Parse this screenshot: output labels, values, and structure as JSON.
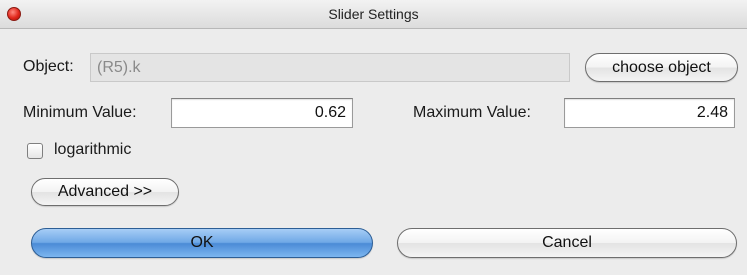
{
  "window": {
    "title": "Slider Settings"
  },
  "object": {
    "label": "Object:",
    "value": "(R5).k",
    "choose_button": "choose object"
  },
  "range": {
    "min_label": "Minimum Value:",
    "min_value": "0.62",
    "max_label": "Maximum Value:",
    "max_value": "2.48"
  },
  "logarithmic": {
    "label": "logarithmic",
    "checked": false
  },
  "advanced_button": "Advanced >>",
  "buttons": {
    "ok": "OK",
    "cancel": "Cancel"
  },
  "colors": {
    "primary_button": "#4b8bd6",
    "window_bg": "#ececec",
    "close_button": "#e0261b"
  }
}
